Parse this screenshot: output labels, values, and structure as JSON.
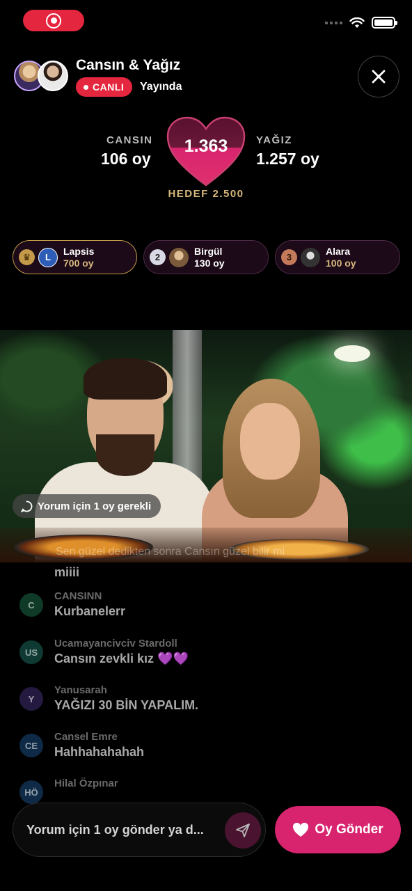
{
  "header": {
    "title": "Cansın & Yağız",
    "live_badge": "CANLI",
    "live_status": "Yayında"
  },
  "score": {
    "left_name": "CANSIN",
    "left_votes": "106 oy",
    "right_name": "YAĞIZ",
    "right_votes": "1.257 oy",
    "total": "1.363",
    "goal": "HEDEF 2.500"
  },
  "leaderboard": [
    {
      "rank": "crown",
      "initial": "L",
      "name": "Lapsis",
      "votes": "700 oy"
    },
    {
      "rank": "2",
      "name": "Birgül",
      "votes": "130 oy"
    },
    {
      "rank": "3",
      "name": "Alara",
      "votes": "100 oy"
    }
  ],
  "video": {
    "comment_requirement": "Yorum için 1 oy gerekli",
    "overlay_comment": "Sen güzel dedikten sonra Cansın güzel bilir mi"
  },
  "comments": {
    "partial_text": "miiii",
    "items": [
      {
        "initials": "C",
        "user": "CANSINN",
        "text": "Kurbanelerr",
        "color": "#0f3a28"
      },
      {
        "initials": "US",
        "user": "Ucamayancivciv Stardoll",
        "text": "Cansın zevkli kız 💜💜",
        "color": "#0f3a34"
      },
      {
        "initials": "Y",
        "user": "Yanusarah",
        "text": "YAĞIZI 30 BİN YAPALIM.",
        "color": "#241a40"
      },
      {
        "initials": "CE",
        "user": "Cansel Emre",
        "text": "Hahhahahahah",
        "color": "#0f2a46"
      },
      {
        "initials": "HÖ",
        "user": "Hilal Özpınar",
        "text": "",
        "color": "#0f2a46"
      }
    ]
  },
  "bottom": {
    "input_placeholder": "Yorum için 1 oy gönder ya d...",
    "vote_button": "Oy Gönder"
  },
  "colors": {
    "accent": "#e5263f",
    "vote_pink": "#d8246e",
    "gold": "#d7b87e"
  }
}
